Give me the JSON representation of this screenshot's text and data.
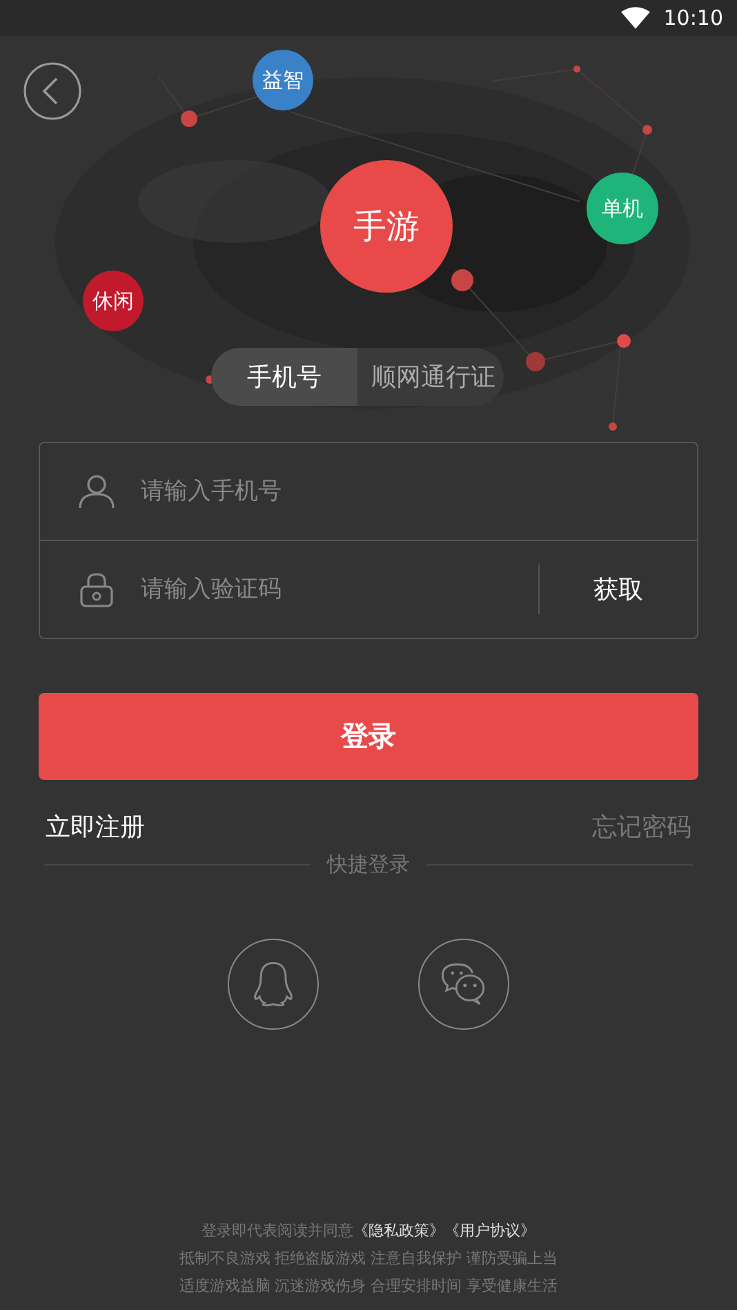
{
  "status_bar": {
    "time": "10:10"
  },
  "tags": [
    {
      "label": "益智",
      "color": "#3a82c8"
    },
    {
      "label": "手游",
      "color": "#e84a4a"
    },
    {
      "label": "单机",
      "color": "#1fb57a"
    },
    {
      "label": "休闲",
      "color": "#c01a2c"
    }
  ],
  "tabs": [
    {
      "label": "手机号",
      "selected": true
    },
    {
      "label": "顺网通行证",
      "selected": false
    }
  ],
  "phone_field": {
    "placeholder": "请输入手机号"
  },
  "code_field": {
    "placeholder": "请输入验证码"
  },
  "get_code_button": "获取",
  "login_button": "登录",
  "register_link": "立即注册",
  "forgot_link": "忘记密码",
  "quick_login_label": "快捷登录",
  "agreement": {
    "text": "登录即代表阅读并同意",
    "links": [
      "《隐私政策》",
      "《用户协议》"
    ]
  },
  "notice_lines": [
    "抵制不良游戏 拒绝盗版游戏 注意自我保护 谨防受骗上当",
    "适度游戏益脑 沉迷游戏伤身 合理安排时间 享受健康生活"
  ]
}
